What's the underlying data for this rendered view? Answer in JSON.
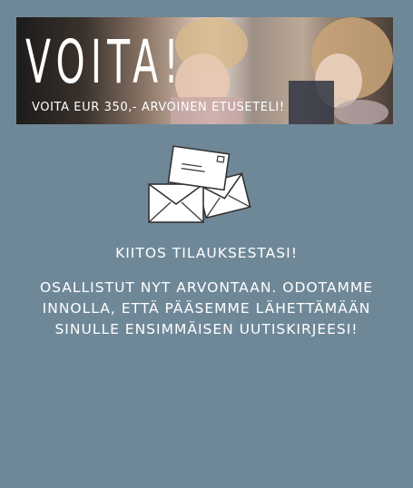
{
  "banner": {
    "title": "VOITA!",
    "subtitle": "VOITA EUR 350,-  ARVOINEN ETUSETELI!"
  },
  "content": {
    "icon": "envelopes-icon",
    "thanks": "KIITOS TILAUKSESTASI!",
    "message": "OSALLISTUT NYT ARVONTAAN. ODOTAMME INNOLLA, ETTÄ PÄÄSEMME LÄHETTÄMÄÄN SINULLE ENSIMMÄISEN UUTISKIRJEESI!"
  },
  "colors": {
    "background": "#6f8898",
    "text": "#ffffff"
  }
}
